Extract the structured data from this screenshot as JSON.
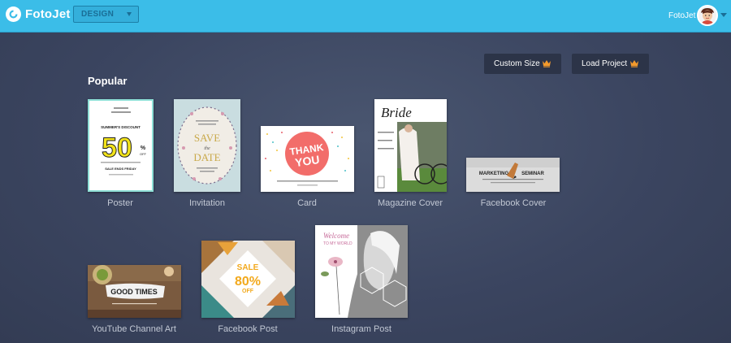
{
  "header": {
    "logo_text": "FotoJet",
    "mode_select": "DESIGN",
    "user_name": "FotoJet"
  },
  "actions": {
    "custom_size": "Custom Size",
    "load_project": "Load Project"
  },
  "section_title": "Popular",
  "templates": [
    {
      "label": "Poster",
      "thumb": {
        "title_a": "SUMMER'S DISCOUNT",
        "big": "50",
        "pct": "%",
        "off": "OFF",
        "footer": "SALE ENDS FRIDAY"
      }
    },
    {
      "label": "Invitation",
      "thumb": {
        "save": "SAVE",
        "the": "the",
        "date": "DATE"
      }
    },
    {
      "label": "Card",
      "thumb": {
        "line1": "THANK",
        "line2": "YOU"
      }
    },
    {
      "label": "Magazine Cover",
      "thumb": {
        "title": "Bride"
      }
    },
    {
      "label": "Facebook Cover",
      "thumb": {
        "left": "MARKETING",
        "right": "SEMINAR"
      }
    },
    {
      "label": "YouTube Channel Art",
      "thumb": {
        "title": "GOOD TIMES"
      }
    },
    {
      "label": "Facebook Post",
      "thumb": {
        "sale": "SALE",
        "pct": "80%",
        "off": "OFF"
      }
    },
    {
      "label": "Instagram Post",
      "thumb": {
        "welcome": "Welcome",
        "sub": "TO MY WORLD"
      }
    }
  ],
  "colors": {
    "topbar": "#3bbde8",
    "accent_crown": "#f39a2c",
    "background": "#3b4560"
  }
}
